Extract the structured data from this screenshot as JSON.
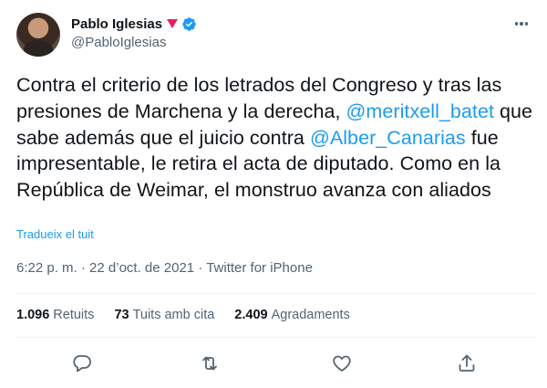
{
  "author": {
    "name": "Pablo Iglesias",
    "handle": "@PabloIglesias"
  },
  "tweet": {
    "parts": [
      {
        "text": "Contra el criterio de los letrados del Congreso y tras las presiones de Marchena y la derecha, ",
        "mention": false
      },
      {
        "text": "@meritxell_batet",
        "mention": true
      },
      {
        "text": " que sabe además que el juicio contra ",
        "mention": false
      },
      {
        "text": "@Alber_Canarias",
        "mention": true
      },
      {
        "text": " fue impresentable, le retira el acta de diputado. Como en la República de Weimar, el monstruo avanza con aliados",
        "mention": false
      }
    ]
  },
  "translate_label": "Tradueix el tuit",
  "meta": {
    "time": "6:22 p. m.",
    "separator": " · ",
    "date": "22 d’oct. de 2021",
    "source": "Twitter for iPhone"
  },
  "stats": {
    "retweets_count": "1.096",
    "retweets_label": "Retuits",
    "quotes_count": "73",
    "quotes_label": "Tuits amb cita",
    "likes_count": "2.409",
    "likes_label": "Agradaments"
  },
  "icons": {
    "reply": "reply-icon",
    "retweet": "retweet-icon",
    "like": "heart-icon",
    "share": "share-icon",
    "verified": "verified-badge-icon",
    "more": "more-icon",
    "rose": "rose-emoji-icon"
  },
  "colors": {
    "accent": "#1d9bf0",
    "text": "#0f1419",
    "secondary": "#536471",
    "divider": "#eff3f4"
  }
}
